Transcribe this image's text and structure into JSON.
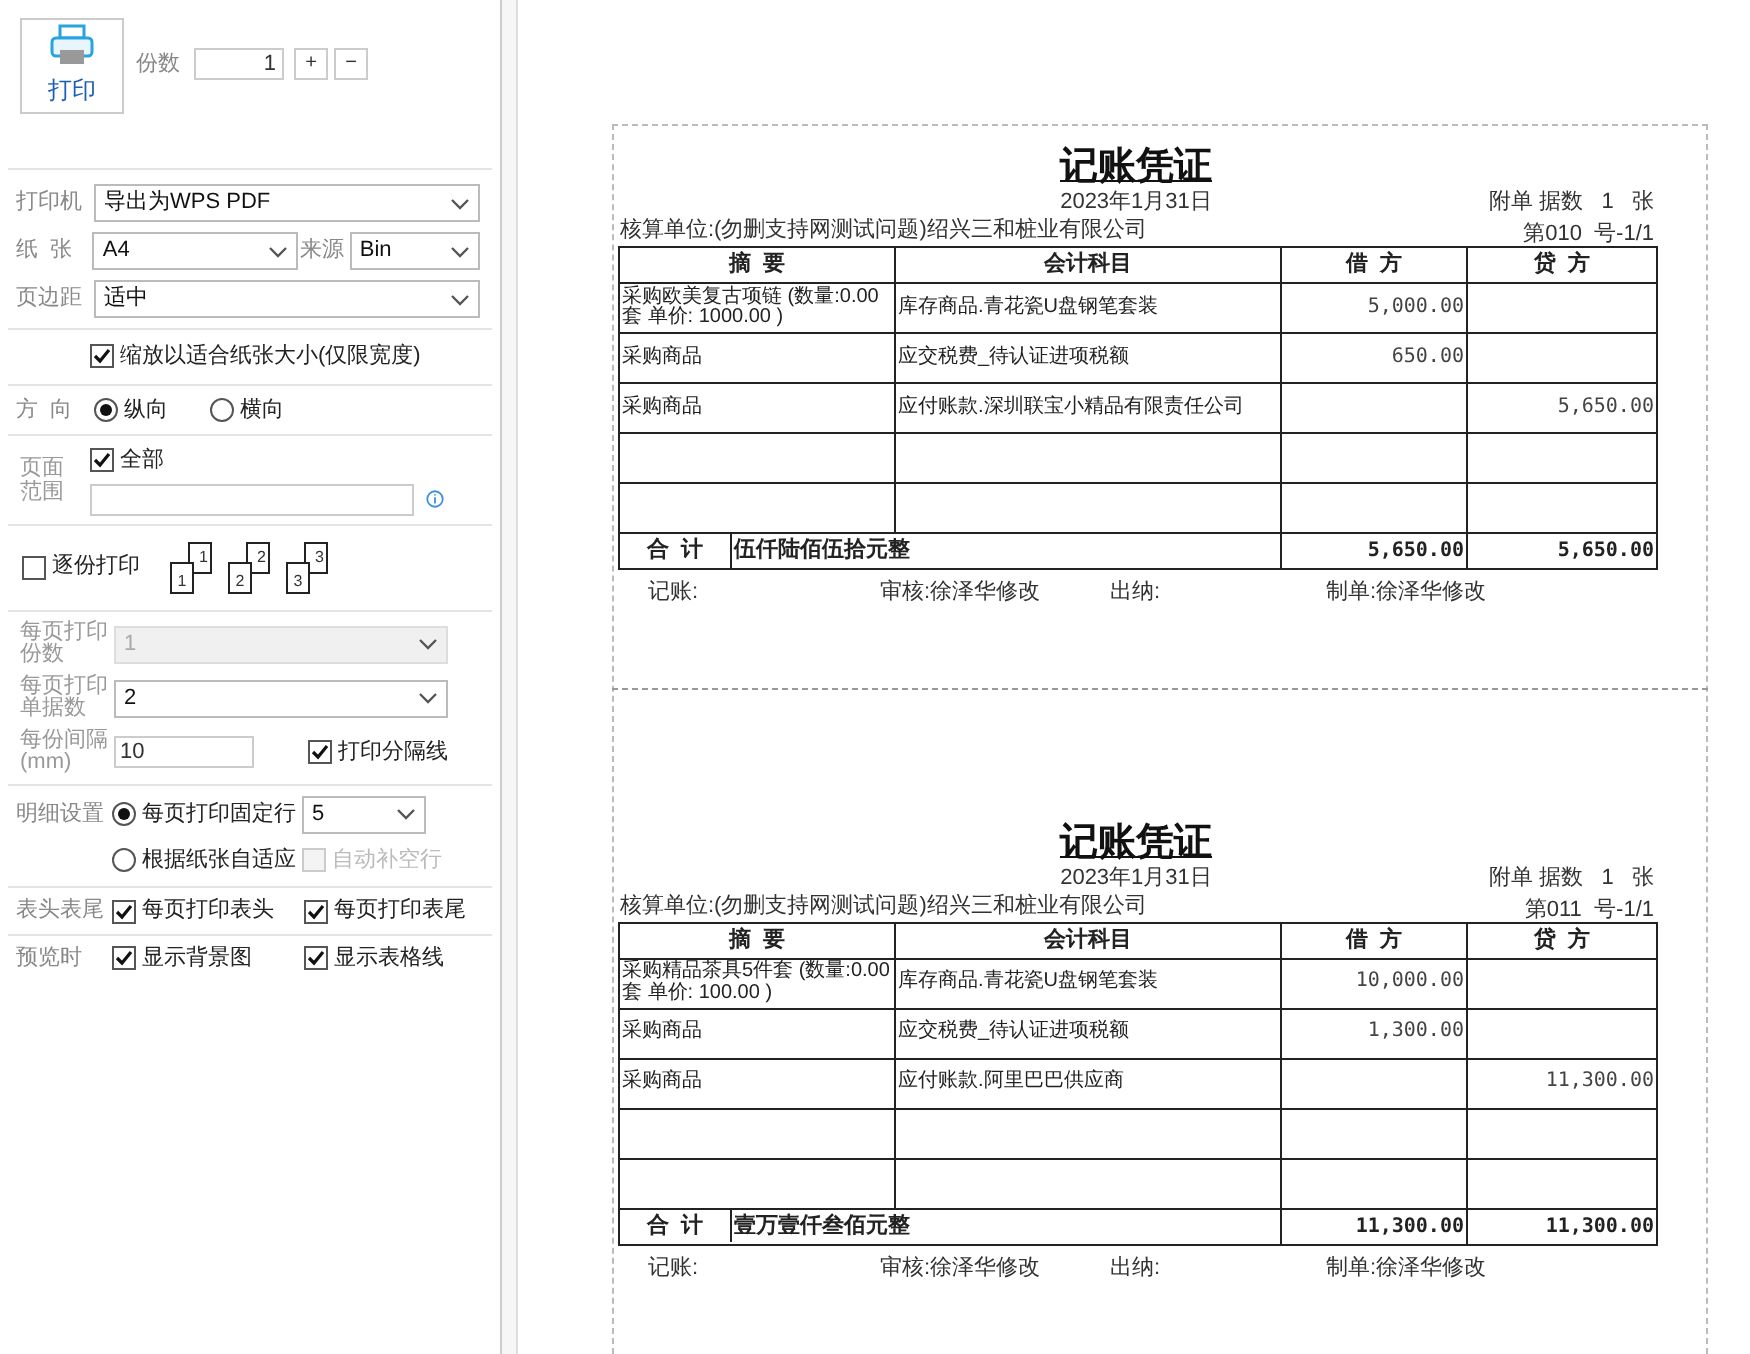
{
  "print_button": {
    "label": "打印"
  },
  "copies": {
    "label": "份数",
    "value": "1",
    "plus": "+",
    "minus": "−"
  },
  "printer": {
    "label": "打印机",
    "value": "导出为WPS PDF"
  },
  "paper": {
    "label": "纸  张",
    "value": "A4"
  },
  "source": {
    "label": "来源",
    "value": "Bin"
  },
  "margin": {
    "label": "页边距",
    "value": "适中"
  },
  "fit_to_paper": {
    "label": "缩放以适合纸张大小(仅限宽度)",
    "checked": true
  },
  "orientation": {
    "label": "方  向",
    "options": [
      {
        "label": "纵向",
        "selected": true
      },
      {
        "label": "横向",
        "selected": false
      }
    ]
  },
  "page_range": {
    "label": "页面范围",
    "all": {
      "label": "全部",
      "checked": true
    }
  },
  "collate": {
    "label": "逐份打印",
    "checked": false,
    "samples": [
      {
        "back": "1",
        "front": "1"
      },
      {
        "back": "2",
        "front": "2"
      },
      {
        "back": "3",
        "front": "3"
      }
    ]
  },
  "copies_per_page": {
    "label": "每页打印份数",
    "value": "1",
    "disabled": true
  },
  "vouchers_per_page": {
    "label": "每页打印单据数",
    "value": "2",
    "disabled": false
  },
  "interval": {
    "label": "每份间隔(mm)",
    "value": "10"
  },
  "separator_line": {
    "label": "打印分隔线",
    "checked": true
  },
  "detail": {
    "label": "明细设置",
    "options": [
      {
        "label": "每页打印固定行",
        "selected": true
      },
      {
        "label": "根据纸张自适应",
        "selected": false
      }
    ],
    "rows_value": "5",
    "auto_fill": {
      "label": "自动补空行",
      "checked": false,
      "disabled": true
    }
  },
  "header_footer": {
    "label": "表头表尾",
    "options": [
      {
        "label": "每页打印表头",
        "checked": true
      },
      {
        "label": "每页打印表尾",
        "checked": true
      }
    ]
  },
  "preview": {
    "label": "预览时",
    "options": [
      {
        "label": "显示背景图",
        "checked": true
      },
      {
        "label": "显示表格线",
        "checked": true
      }
    ]
  },
  "vouchers": [
    {
      "title": "记账凭证",
      "date": "2023年1月31日",
      "attachment": "附单 据数   1   张",
      "unit": "核算单位:(勿删支持网测试问题)绍兴三和桩业有限公司",
      "number": "第010  号-1/1",
      "headers": [
        "摘  要",
        "会计科目",
        "借  方",
        "贷  方"
      ],
      "rows": [
        {
          "summary": "采购欧美复古项链 (数量:0.00套  单价: 1000.00  )",
          "account": "库存商品.青花瓷U盘钢笔套装",
          "debit": "5,000.00"
        },
        {
          "summary": "采购商品",
          "account": "应交税费_待认证进项税额",
          "debit": "650.00"
        },
        {
          "summary": "采购商品",
          "account": "应付账款.深圳联宝小精品有限责任公司",
          "credit": "5,650.00"
        },
        {},
        {}
      ],
      "total": {
        "label": "合  计",
        "words": "伍仟陆佰伍拾元整",
        "debit": "5,650.00",
        "credit": "5,650.00"
      },
      "signatures": [
        "记账:",
        "审核:徐泽华修改",
        "出纳:",
        "制单:徐泽华修改"
      ]
    },
    {
      "title": "记账凭证",
      "date": "2023年1月31日",
      "attachment": "附单 据数   1   张",
      "unit": "核算单位:(勿删支持网测试问题)绍兴三和桩业有限公司",
      "number": "第011  号-1/1",
      "headers": [
        "摘  要",
        "会计科目",
        "借  方",
        "贷  方"
      ],
      "rows": [
        {
          "summary": "采购精品茶具5件套 (数量:0.00套  单价: 100.00  )",
          "account": "库存商品.青花瓷U盘钢笔套装",
          "debit": "10,000.00"
        },
        {
          "summary": "采购商品",
          "account": "应交税费_待认证进项税额",
          "debit": "1,300.00"
        },
        {
          "summary": "采购商品",
          "account": "应付账款.阿里巴巴供应商",
          "credit": "11,300.00"
        },
        {},
        {}
      ],
      "total": {
        "label": "合  计",
        "words": "壹万壹仟叁佰元整",
        "debit": "11,300.00",
        "credit": "11,300.00"
      },
      "signatures": [
        "记账:",
        "审核:徐泽华修改",
        "出纳:",
        "制单:徐泽华修改"
      ]
    }
  ]
}
